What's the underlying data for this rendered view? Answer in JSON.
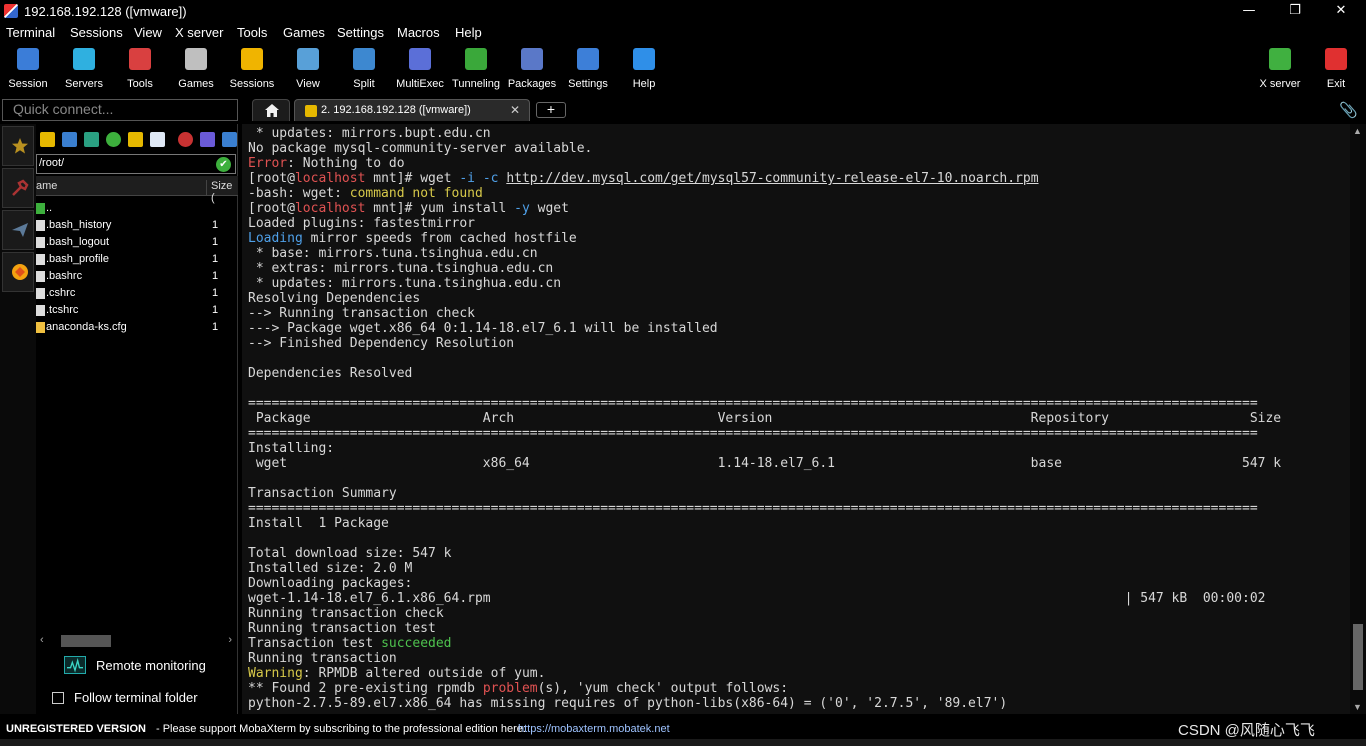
{
  "window": {
    "title": "192.168.192.128 ([vmware])",
    "controls": [
      "—",
      "❐",
      "✕"
    ]
  },
  "menu": [
    "Terminal",
    "Sessions",
    "View",
    "X server",
    "Tools",
    "Games",
    "Settings",
    "Macros",
    "Help"
  ],
  "toolbar": {
    "left": [
      {
        "label": "Session",
        "icon": "session-icon",
        "color": "#3b7dd8"
      },
      {
        "label": "Servers",
        "icon": "servers-icon",
        "color": "#2fb0e0"
      },
      {
        "label": "Tools",
        "icon": "tools-icon",
        "color": "#d94040"
      },
      {
        "label": "Games",
        "icon": "games-icon",
        "color": "#bfbfbf"
      },
      {
        "label": "Sessions",
        "icon": "star-icon",
        "color": "#f0b400"
      },
      {
        "label": "View",
        "icon": "view-icon",
        "color": "#58a0d8"
      },
      {
        "label": "Split",
        "icon": "split-icon",
        "color": "#3d88d0"
      },
      {
        "label": "MultiExec",
        "icon": "multiexec-icon",
        "color": "#5b6fd8"
      },
      {
        "label": "Tunneling",
        "icon": "tunneling-icon",
        "color": "#3aa83a"
      },
      {
        "label": "Packages",
        "icon": "packages-icon",
        "color": "#5a78c8"
      },
      {
        "label": "Settings",
        "icon": "settings-icon",
        "color": "#3d7fd8"
      },
      {
        "label": "Help",
        "icon": "help-icon",
        "color": "#2f8fe8"
      }
    ],
    "right": [
      {
        "label": "X server",
        "icon": "xserver-icon",
        "color": "#40b040"
      },
      {
        "label": "Exit",
        "icon": "power-icon",
        "color": "#e03030"
      }
    ]
  },
  "quick_connect": {
    "placeholder": "Quick connect..."
  },
  "tabs": {
    "session_label": "2. 192.168.192.128 ([vmware])",
    "close": "✕",
    "new": "+"
  },
  "filebrowser": {
    "path": "/root/",
    "header_name": "ame",
    "header_size": "Size (",
    "files": [
      {
        "name": "..",
        "size": ""
      },
      {
        "name": ".bash_history",
        "size": "1"
      },
      {
        "name": ".bash_logout",
        "size": "1"
      },
      {
        "name": ".bash_profile",
        "size": "1"
      },
      {
        "name": ".bashrc",
        "size": "1"
      },
      {
        "name": ".cshrc",
        "size": "1"
      },
      {
        "name": ".tcshrc",
        "size": "1"
      },
      {
        "name": "anaconda-ks.cfg",
        "size": "1"
      }
    ],
    "remote_monitoring": "Remote monitoring",
    "follow_folder": "Follow terminal folder"
  },
  "terminal": {
    "lines": [
      [
        {
          "t": " * updates: mirrors.bupt.edu.cn"
        }
      ],
      [
        {
          "t": "No package mysql-community-server available."
        }
      ],
      [
        {
          "t": "Error",
          "c": "c-red"
        },
        {
          "t": ": Nothing to do"
        }
      ],
      [
        {
          "t": "[root@"
        },
        {
          "t": "localhost",
          "c": "c-red"
        },
        {
          "t": " mnt]# wget "
        },
        {
          "t": "-i -c",
          "c": "c-flag"
        },
        {
          "t": " "
        },
        {
          "t": "http://dev.mysql.com/get/mysql57-community-release-el7-10.noarch.rpm",
          "c": "c-link"
        }
      ],
      [
        {
          "t": "-bash: wget: "
        },
        {
          "t": "command not found",
          "c": "c-yellow"
        }
      ],
      [
        {
          "t": "[root@"
        },
        {
          "t": "localhost",
          "c": "c-red"
        },
        {
          "t": " mnt]# yum install "
        },
        {
          "t": "-y",
          "c": "c-flag"
        },
        {
          "t": " wget"
        }
      ],
      [
        {
          "t": "Loaded plugins: fastestmirror"
        }
      ],
      [
        {
          "t": "Loading",
          "c": "c-blue"
        },
        {
          "t": " mirror speeds from cached hostfile"
        }
      ],
      [
        {
          "t": " * base: mirrors.tuna.tsinghua.edu.cn"
        }
      ],
      [
        {
          "t": " * extras: mirrors.tuna.tsinghua.edu.cn"
        }
      ],
      [
        {
          "t": " * updates: mirrors.tuna.tsinghua.edu.cn"
        }
      ],
      [
        {
          "t": "Resolving Dependencies"
        }
      ],
      [
        {
          "t": "--> Running transaction check"
        }
      ],
      [
        {
          "t": "---> Package wget.x86_64 0:1.14-18.el7_6.1 will be installed"
        }
      ],
      [
        {
          "t": "--> Finished Dependency Resolution"
        }
      ],
      [
        {
          "t": ""
        }
      ],
      [
        {
          "t": "Dependencies Resolved"
        }
      ],
      [
        {
          "t": ""
        }
      ],
      [
        {
          "t": "================================================================================================================================="
        }
      ],
      [
        {
          "t": " Package                      Arch                          Version                                 Repository                  Size"
        }
      ],
      [
        {
          "t": "================================================================================================================================="
        }
      ],
      [
        {
          "t": "Installing:"
        }
      ],
      [
        {
          "t": " wget                         x86_64                        1.14-18.el7_6.1                         base                       547 k"
        }
      ],
      [
        {
          "t": ""
        }
      ],
      [
        {
          "t": "Transaction Summary"
        }
      ],
      [
        {
          "t": "================================================================================================================================="
        }
      ],
      [
        {
          "t": "Install  1 Package"
        }
      ],
      [
        {
          "t": ""
        }
      ],
      [
        {
          "t": "Total download size: 547 k"
        }
      ],
      [
        {
          "t": "Installed size: 2.0 M"
        }
      ],
      [
        {
          "t": "Downloading packages:"
        }
      ],
      [
        {
          "t": "wget-1.14-18.el7_6.1.x86_64.rpm                                                                                 | 547 kB  00:00:02"
        }
      ],
      [
        {
          "t": "Running transaction check"
        }
      ],
      [
        {
          "t": "Running transaction test"
        }
      ],
      [
        {
          "t": "Transaction test "
        },
        {
          "t": "succeeded",
          "c": "c-green"
        }
      ],
      [
        {
          "t": "Running transaction"
        }
      ],
      [
        {
          "t": "Warning",
          "c": "c-yellow"
        },
        {
          "t": ": RPMDB altered outside of yum."
        }
      ],
      [
        {
          "t": "** Found 2 pre-existing rpmdb "
        },
        {
          "t": "problem",
          "c": "c-red"
        },
        {
          "t": "(s), 'yum check' output follows:"
        }
      ],
      [
        {
          "t": "python-2.7.5-89.el7.x86_64 has missing requires of python-libs(x86-64) = ('0', '2.7.5', '89.el7')"
        }
      ]
    ]
  },
  "statusbar": {
    "unregistered": "UNREGISTERED VERSION",
    "support": "-  Please support MobaXterm by subscribing to the professional edition here:",
    "url": "https://mobaxterm.mobatek.net",
    "watermark": "CSDN @风随心飞飞"
  }
}
